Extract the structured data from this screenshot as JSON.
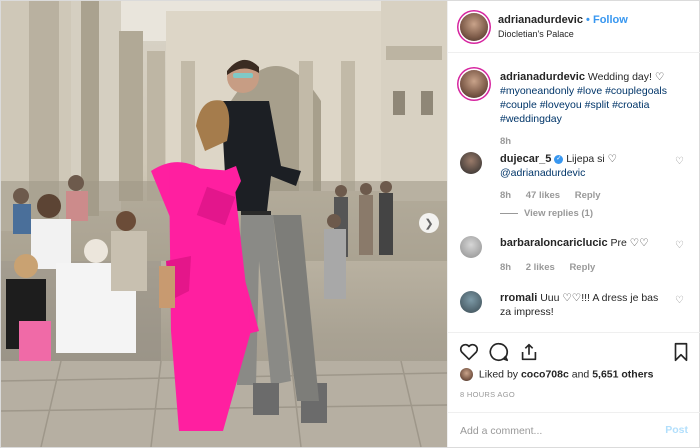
{
  "post": {
    "username": "adrianadurdevic",
    "follow_sep": "•",
    "follow_label": "Follow",
    "location": "Diocletian's Palace"
  },
  "caption": {
    "username": "adrianadurdevic",
    "text": "Wedding day! ♡",
    "hashtags": "#myoneandonly #love #couplegoals #couple #loveyou #split #croatia #weddingday",
    "time": "8h"
  },
  "comments": [
    {
      "username": "dujecar_5",
      "verified": true,
      "text": "Lijepa si ♡",
      "mention": "@adrianadurdevic",
      "time": "8h",
      "likes": "47 likes",
      "reply": "Reply",
      "view_replies": "View replies (1)"
    },
    {
      "username": "barbaraloncariclucic",
      "text": "Pre ♡♡",
      "time": "8h",
      "likes": "2 likes",
      "reply": "Reply"
    },
    {
      "username": "rromali",
      "text": "Uuu ♡♡!!! A dress je bas za impress!"
    }
  ],
  "actions": {
    "liked_prefix": "Liked by",
    "liked_user": "coco708c",
    "liked_and": "and",
    "liked_count": "5,651 others",
    "time_ago": "8 HOURS AGO"
  },
  "add_comment": {
    "placeholder": "Add a comment...",
    "post_label": "Post"
  },
  "colors": {
    "link": "#3897f0",
    "dress": "#ff1fa0",
    "hashtag": "#003569"
  }
}
